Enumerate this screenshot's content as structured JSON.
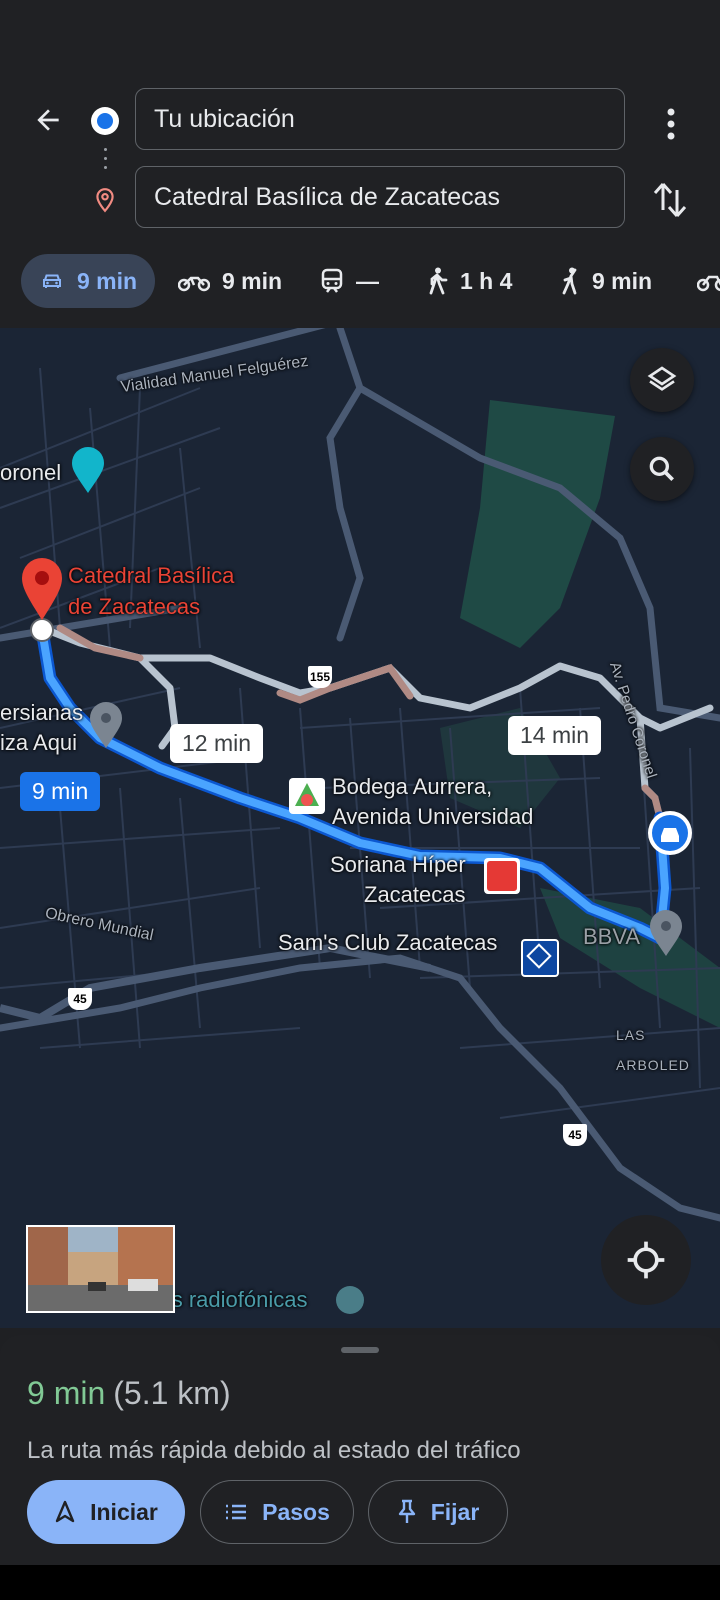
{
  "search": {
    "origin_value": "Tu ubicación",
    "destination_value": "Catedral Basílica de Zacatecas"
  },
  "icons": [
    "back-arrow-icon",
    "origin-dot-icon",
    "destination-pin-icon",
    "more-vert-icon",
    "swap-icon",
    "car-icon",
    "motorcycle-icon",
    "transit-icon",
    "walk-icon",
    "ride-icon",
    "bike-icon",
    "layers-icon",
    "search-icon",
    "my-location-icon",
    "navigation-icon",
    "list-icon",
    "pin-icon"
  ],
  "modes": [
    {
      "mode": "car",
      "label": "9 min",
      "selected": true
    },
    {
      "mode": "motorcycle",
      "label": "9 min"
    },
    {
      "mode": "transit",
      "label": "—"
    },
    {
      "mode": "walk",
      "label": "1 h 4"
    },
    {
      "mode": "ride",
      "label": "9 min"
    }
  ],
  "map": {
    "destination_label_line1": "Catedral Basílica",
    "destination_label_line2": "de Zacatecas",
    "street_felguerez": "Vialidad Manuel Felguérez",
    "coronel_left": "oronel",
    "persianas_line1": "ersianas",
    "persianas_line2": "iza Aqui",
    "bodega_line1": "Bodega Aurrera,",
    "bodega_line2": "Avenida Universidad",
    "soriana_line1": "Soriana Híper",
    "soriana_line2": "Zacatecas",
    "sams": "Sam's Club Zacatecas",
    "bbva": "BBVA",
    "obrero": "Obrero Mundial",
    "arboledas": "LAS ARBOLED",
    "antenas": "Antenas radiofónicas",
    "av_pedro": "Av. Pedro Coronel",
    "route_main_time": "9 min",
    "route_alt1_time": "12 min",
    "route_alt2_time": "14 min",
    "shield_155": "155",
    "shield_45a": "45",
    "shield_45b": "45"
  },
  "sheet": {
    "eta_time": "9 min",
    "eta_distance": "(5.1 km)",
    "description": "La ruta más rápida debido al estado del tráfico",
    "start_label": "Iniciar",
    "steps_label": "Pasos",
    "pin_label": "Fijar"
  },
  "colors": {
    "route_primary": "#1a73e8",
    "route_alt": "#b8c3cf",
    "traffic_slow": "#b08a84",
    "accent": "#8ab4f8",
    "eta_green": "#81c995",
    "destination_red": "#ea4335"
  }
}
